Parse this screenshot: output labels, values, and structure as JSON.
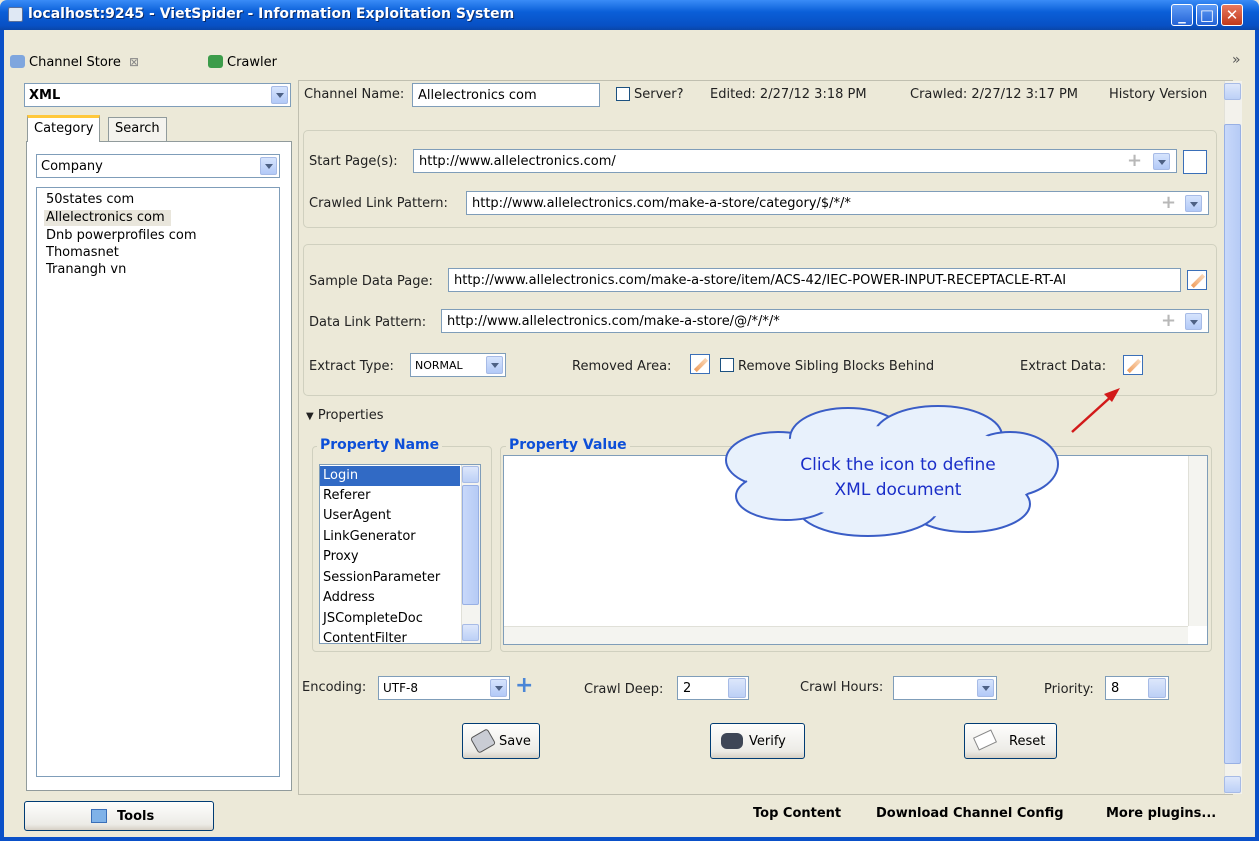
{
  "window": {
    "title": "localhost:9245 - VietSpider - Information Exploitation System"
  },
  "tabs": [
    {
      "label": "Channel Store"
    },
    {
      "label": "Crawler"
    }
  ],
  "left": {
    "data_type": "XML",
    "subtabs": [
      "Category",
      "Search"
    ],
    "category": "Company",
    "channels": [
      "50states com",
      "Allelectronics com",
      "Dnb powerprofiles com",
      "Thomasnet",
      "Tranangh vn"
    ]
  },
  "header": {
    "channel_name_label": "Channel Name:",
    "channel_name": "Allelectronics com",
    "server_label": "Server?",
    "edited": "Edited: 2/27/12 3:18 PM",
    "crawled": "Crawled: 2/27/12 3:17 PM",
    "history": "History Version"
  },
  "start": {
    "start_pages_label": "Start Page(s):",
    "start_pages": "http://www.allelectronics.com/",
    "crawled_link_label": "Crawled Link Pattern:",
    "crawled_link": "http://www.allelectronics.com/make-a-store/category/$/*/*"
  },
  "sample": {
    "sample_page_label": "Sample Data Page:",
    "sample_page": "http://www.allelectronics.com/make-a-store/item/ACS-42/IEC-POWER-INPUT-RECEPTACLE-RT-AI",
    "data_link_label": "Data Link Pattern:",
    "data_link": "http://www.allelectronics.com/make-a-store/@/*/*/*",
    "extract_type_label": "Extract Type:",
    "extract_type": "NORMAL",
    "removed_area_label": "Removed Area:",
    "remove_sibling_label": "Remove Sibling Blocks Behind",
    "extract_data_label": "Extract Data:"
  },
  "properties": {
    "toggle_label": "Properties",
    "name_legend": "Property Name",
    "value_legend": "Property Value",
    "names": [
      "Login",
      "Referer",
      "UserAgent",
      "LinkGenerator",
      "Proxy",
      "SessionParameter",
      "Address",
      "JSCompleteDoc",
      "ContentFilter"
    ]
  },
  "callout": {
    "line1": "Click the icon to define",
    "line2": "XML document"
  },
  "settings": {
    "encoding_label": "Encoding:",
    "encoding": "UTF-8",
    "crawl_deep_label": "Crawl Deep:",
    "crawl_deep": "2",
    "crawl_hours_label": "Crawl Hours:",
    "crawl_hours": "",
    "priority_label": "Priority:",
    "priority": "8"
  },
  "actions": {
    "save": "Save",
    "verify": "Verify",
    "reset": "Reset"
  },
  "footer": {
    "tools": "Tools",
    "top_content": "Top Content",
    "download_config": "Download Channel Config",
    "more_plugins": "More plugins..."
  },
  "colors": {
    "title_bar": "#0a5fd8",
    "legend": "#0d4fd8",
    "selection": "#316ac5",
    "callout_text": "#1a2ec8"
  }
}
